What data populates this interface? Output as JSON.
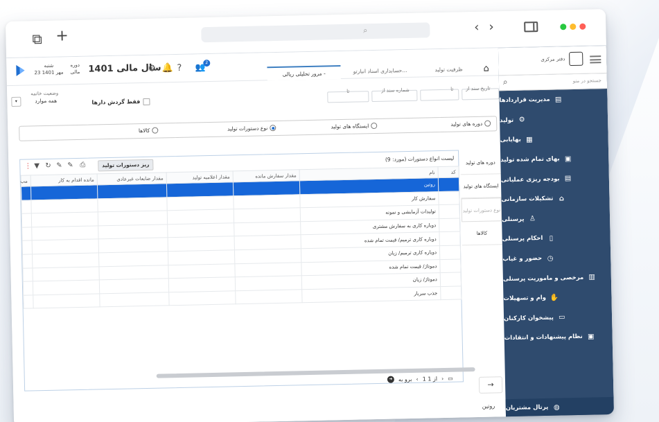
{
  "window": {
    "accent": "#1666d8",
    "sidebar_color": "#2f4b6e",
    "traffic_lights": [
      "#ff5f57",
      "#febc2e",
      "#28c840"
    ]
  },
  "header": {
    "fiscal_year": "سال مالی 1401",
    "period_label": "دوره",
    "period_sub": "مالی",
    "day": "شنبه",
    "date": "23 مهر 1401",
    "notification_count": "2"
  },
  "tabs": [
    {
      "label": "مرور تحلیلی ریالی -",
      "active": true
    },
    {
      "label": "حسابداری اسناد انبارتو...",
      "active": false
    },
    {
      "label": "ظرفیت تولید",
      "active": false
    }
  ],
  "filters": {
    "date_from": "تاریخ سند از",
    "to1": "تا",
    "doc_no_from": "شماره سند از",
    "to2": "تا",
    "only_turnover": "فقط گردش دارها",
    "status_label": "وضعیت خاتمه",
    "status_value": "همه موارد"
  },
  "radios": [
    {
      "label": "دوره های تولید",
      "selected": false
    },
    {
      "label": "ایستگاه های تولید",
      "selected": false
    },
    {
      "label": "نوع دستورات تولید",
      "selected": true
    },
    {
      "label": "کالاها",
      "selected": false
    }
  ],
  "vtabs": [
    "دوره های تولید",
    "ایستگاه های تولید",
    "نوع دستورات تولید",
    "کالاها"
  ],
  "grid": {
    "title": "لیست انواع دستورات (مورد: 9)",
    "breakdown_button": "ریز دستورات تولید",
    "columns": [
      "کد",
      "نام",
      "مقدار سفارش مانده",
      "مقدار اعلامیه تولید",
      "مقدار ضایعات غیرعادی",
      "مانده اقدام به کار",
      "مب"
    ],
    "rows": [
      "روتین",
      "سفارش کار",
      "تولیدات آزمایشی و نمونه",
      "دوباره کاری به سفارش مشتری",
      "دوباره کاری ترمیم/ قیمت تمام شده",
      "دوباره کاری ترمیم/ زیان",
      "دموتاژ/ قیمت تمام شده",
      "دموتاژ/ زیان",
      "جذب سربار"
    ]
  },
  "pager": {
    "page_text": "1 از 1",
    "goto": "برو به"
  },
  "footer_label": "روتین",
  "sidebar": {
    "office": "دفتر مرکزی",
    "search_placeholder": "جستجو در منو",
    "items": [
      {
        "label": "مدیریت قراردادها",
        "icon": "contract-icon"
      },
      {
        "label": "تولید",
        "icon": "gear-icon"
      },
      {
        "label": "بهایابی",
        "icon": "calculator-icon"
      },
      {
        "label": "بهای تمام شده تولید",
        "icon": "cost-icon"
      },
      {
        "label": "بودجه ریزی عملیاتی",
        "icon": "budget-icon"
      },
      {
        "label": "تشکیلات سازمانی",
        "icon": "org-icon"
      },
      {
        "label": "پرسنلی",
        "icon": "person-icon"
      },
      {
        "label": "احکام پرسنلی",
        "icon": "document-icon"
      },
      {
        "label": "حضور و غیاب",
        "icon": "clock-icon"
      },
      {
        "label": "مرخصی و ماموریت پرسنلی",
        "icon": "leave-icon"
      },
      {
        "label": "وام و تسهیلات",
        "icon": "loan-icon"
      },
      {
        "label": "پیشخوان کارکنان",
        "icon": "desk-icon"
      },
      {
        "label": "نظام پیشنهادات و انتقادات",
        "icon": "suggestion-icon"
      }
    ],
    "portal": "پرتال مشتریان"
  }
}
